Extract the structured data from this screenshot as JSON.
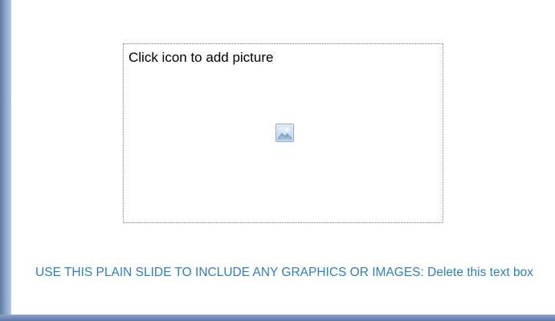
{
  "slide": {
    "placeholder": {
      "prompt": "Click icon to add picture",
      "icon": "insert-picture-icon"
    },
    "caption": "USE THIS PLAIN SLIDE TO INCLUDE ANY GRAPHICS OR IMAGES: Delete this text box"
  },
  "colors": {
    "caption_text": "#2e7fc6",
    "frame": "#6e8ab0",
    "slide_background": "#ffffff"
  }
}
